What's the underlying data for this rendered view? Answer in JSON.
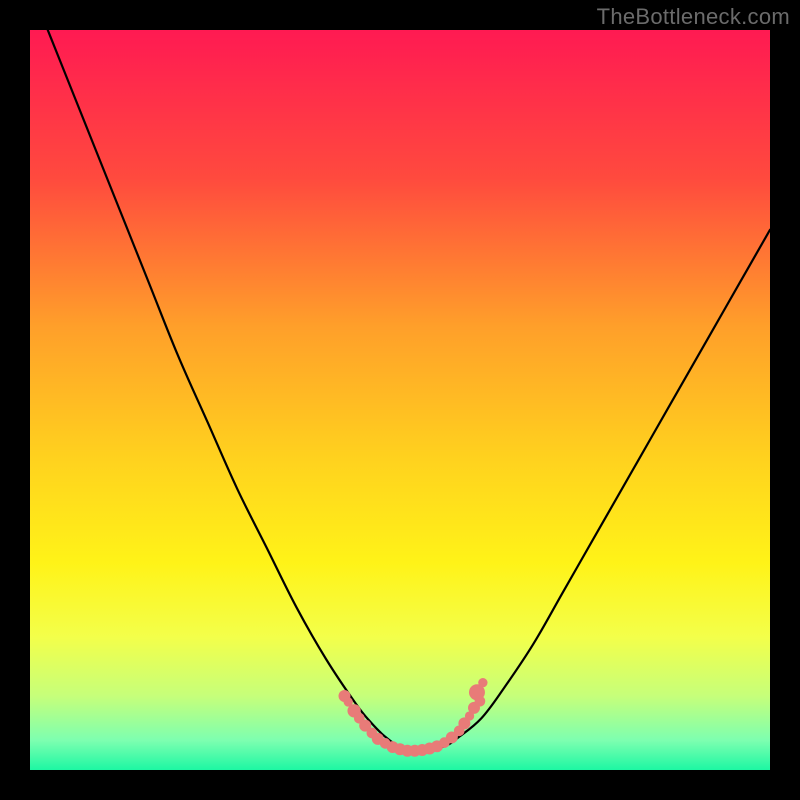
{
  "attribution": "TheBottleneck.com",
  "chart_data": {
    "type": "line",
    "title": "",
    "xlabel": "",
    "ylabel": "",
    "xlim": [
      0,
      100
    ],
    "ylim": [
      0,
      100
    ],
    "grid": false,
    "legend": false,
    "background_gradient": {
      "stops": [
        {
          "offset": 0.0,
          "color": "#ff1a52"
        },
        {
          "offset": 0.2,
          "color": "#ff4a3e"
        },
        {
          "offset": 0.4,
          "color": "#ff9f2a"
        },
        {
          "offset": 0.58,
          "color": "#ffd21e"
        },
        {
          "offset": 0.72,
          "color": "#fff318"
        },
        {
          "offset": 0.82,
          "color": "#f3ff4a"
        },
        {
          "offset": 0.9,
          "color": "#c6ff7a"
        },
        {
          "offset": 0.96,
          "color": "#7dffb0"
        },
        {
          "offset": 1.0,
          "color": "#1df7a3"
        }
      ]
    },
    "series": [
      {
        "name": "bottleneck-curve",
        "color": "#000000",
        "x": [
          0,
          4,
          8,
          12,
          16,
          20,
          24,
          28,
          32,
          36,
          40,
          44,
          46,
          48,
          50,
          53,
          56,
          58,
          61,
          64,
          68,
          72,
          76,
          80,
          84,
          88,
          92,
          96,
          100
        ],
        "y": [
          106,
          96,
          86,
          76,
          66,
          56,
          47,
          38,
          30,
          22,
          15,
          9,
          6.5,
          4.5,
          3.2,
          2.6,
          3.2,
          4.5,
          7,
          11,
          17,
          24,
          31,
          38,
          45,
          52,
          59,
          66,
          73
        ]
      }
    ],
    "markers": {
      "name": "bottom-dots",
      "color": "#e87b78",
      "points": [
        {
          "x": 42.5,
          "y": 10.0,
          "r": 0.9
        },
        {
          "x": 43.0,
          "y": 9.2,
          "r": 0.7
        },
        {
          "x": 43.8,
          "y": 8.0,
          "r": 1.0
        },
        {
          "x": 44.5,
          "y": 7.0,
          "r": 0.8
        },
        {
          "x": 45.3,
          "y": 6.0,
          "r": 0.9
        },
        {
          "x": 46.2,
          "y": 5.0,
          "r": 0.8
        },
        {
          "x": 47.0,
          "y": 4.2,
          "r": 0.9
        },
        {
          "x": 48.0,
          "y": 3.6,
          "r": 0.8
        },
        {
          "x": 49.0,
          "y": 3.1,
          "r": 0.9
        },
        {
          "x": 50.0,
          "y": 2.8,
          "r": 0.9
        },
        {
          "x": 51.0,
          "y": 2.6,
          "r": 0.9
        },
        {
          "x": 52.0,
          "y": 2.6,
          "r": 0.9
        },
        {
          "x": 53.0,
          "y": 2.7,
          "r": 0.9
        },
        {
          "x": 54.0,
          "y": 2.9,
          "r": 0.9
        },
        {
          "x": 55.0,
          "y": 3.2,
          "r": 0.9
        },
        {
          "x": 56.0,
          "y": 3.7,
          "r": 0.8
        },
        {
          "x": 57.0,
          "y": 4.4,
          "r": 0.9
        },
        {
          "x": 58.0,
          "y": 5.3,
          "r": 0.8
        },
        {
          "x": 58.7,
          "y": 6.3,
          "r": 0.9
        },
        {
          "x": 59.4,
          "y": 7.3,
          "r": 0.7
        },
        {
          "x": 60.0,
          "y": 8.4,
          "r": 0.9
        },
        {
          "x": 60.4,
          "y": 10.5,
          "r": 1.2
        },
        {
          "x": 60.8,
          "y": 9.3,
          "r": 0.8
        },
        {
          "x": 61.2,
          "y": 11.8,
          "r": 0.7
        }
      ]
    }
  }
}
